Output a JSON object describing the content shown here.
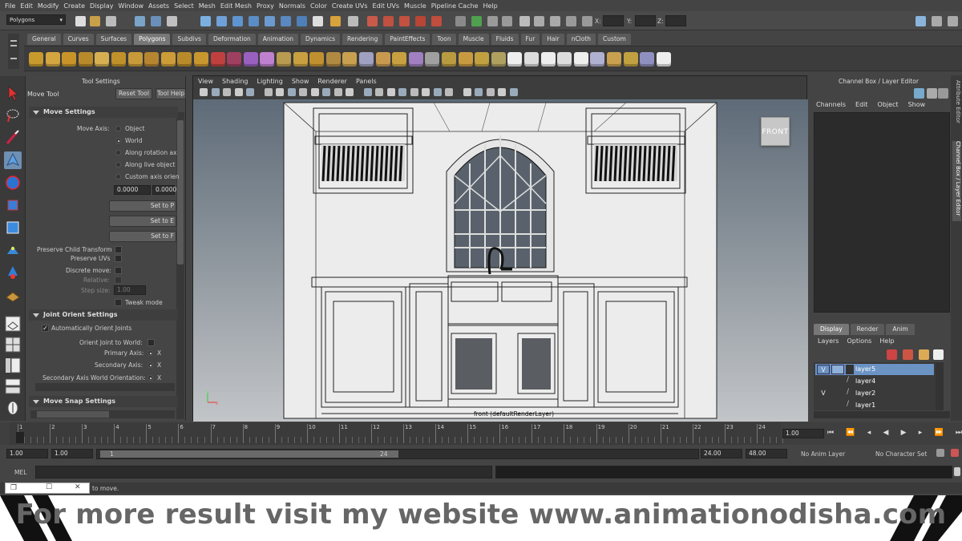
{
  "menus": [
    "File",
    "Edit",
    "Modify",
    "Create",
    "Display",
    "Window",
    "Assets",
    "Select",
    "Mesh",
    "Edit Mesh",
    "Proxy",
    "Normals",
    "Color",
    "Create UVs",
    "Edit UVs",
    "Muscle",
    "Pipeline Cache",
    "Help"
  ],
  "status": {
    "mode": "Polygons",
    "x_label": "X:",
    "y_label": "Y:",
    "z_label": "Z:"
  },
  "shelf_tabs": [
    "General",
    "Curves",
    "Surfaces",
    "Polygons",
    "Subdivs",
    "Deformation",
    "Animation",
    "Dynamics",
    "Rendering",
    "PaintEffects",
    "Toon",
    "Muscle",
    "Fluids",
    "Fur",
    "Hair",
    "nCloth",
    "Custom"
  ],
  "shelf_active": "Polygons",
  "tool_settings": {
    "panel_title": "Tool Settings",
    "tool_name": "Move Tool",
    "reset": "Reset Tool",
    "help": "Tool Help",
    "move_settings": "Move Settings",
    "move_axis": "Move Axis:",
    "axis_options": [
      "Object",
      "World",
      "Along rotation ax",
      "Along live object",
      "Custom axis orien"
    ],
    "axis_selected": "World",
    "custom_vals": [
      "0.0000",
      "0.0000"
    ],
    "set_buttons": [
      "Set to P",
      "Set to E",
      "Set to F"
    ],
    "preserve_child": "Preserve Child Transform",
    "preserve_uvs": "Preserve UVs",
    "discrete_move": "Discrete move:",
    "relative": "Relative:",
    "step_size": "Step size:",
    "step_val": "1.00",
    "tweak_mode": "Tweak mode",
    "joint_orient": "Joint Orient Settings",
    "auto_orient": "Automatically Orient Joints",
    "orient_world": "Orient Joint to World:",
    "primary_axis": "Primary Axis:",
    "secondary_axis": "Secondary Axis:",
    "secondary_world": "Secondary Axis World Orientation:",
    "axis_x": "X",
    "move_snap": "Move Snap Settings"
  },
  "viewport": {
    "menus": [
      "View",
      "Shading",
      "Lighting",
      "Show",
      "Renderer",
      "Panels"
    ],
    "cube_label": "FRONT",
    "camera_label": "front (defaultRenderLayer)"
  },
  "channel_box": {
    "title": "Channel Box / Layer Editor",
    "menus": [
      "Channels",
      "Edit",
      "Object",
      "Show"
    ]
  },
  "layer_editor": {
    "tabs": [
      "Display",
      "Render",
      "Anim"
    ],
    "tab_active": "Display",
    "menus": [
      "Layers",
      "Options",
      "Help"
    ],
    "layers": [
      {
        "name": "layer5",
        "v": "V",
        "selected": true
      },
      {
        "name": "layer4",
        "v": "",
        "selected": false
      },
      {
        "name": "layer2",
        "v": "V",
        "selected": false
      },
      {
        "name": "layer1",
        "v": "",
        "selected": false
      }
    ]
  },
  "side_tabs": [
    "Attribute Editor",
    "Channel Box / Layer Editor"
  ],
  "timeline": {
    "ticks": [
      "1",
      "2",
      "3",
      "4",
      "5",
      "6",
      "7",
      "8",
      "9",
      "10",
      "11",
      "12",
      "13",
      "14",
      "15",
      "16",
      "17",
      "18",
      "19",
      "20",
      "21",
      "22",
      "23",
      "24"
    ],
    "current_frame": "1",
    "frame_field": "1.00"
  },
  "range": {
    "start": "1.00",
    "inner_start": "1.00",
    "slider_start": "1",
    "slider_end": "24",
    "end": "24.00",
    "anim_end": "48.00",
    "anim_layer": "No Anim Layer",
    "char_set": "No Character Set"
  },
  "cmd": {
    "label": "MEL"
  },
  "help_text": "to move.",
  "banner": "For more result visit my website www.animationodisha.com"
}
